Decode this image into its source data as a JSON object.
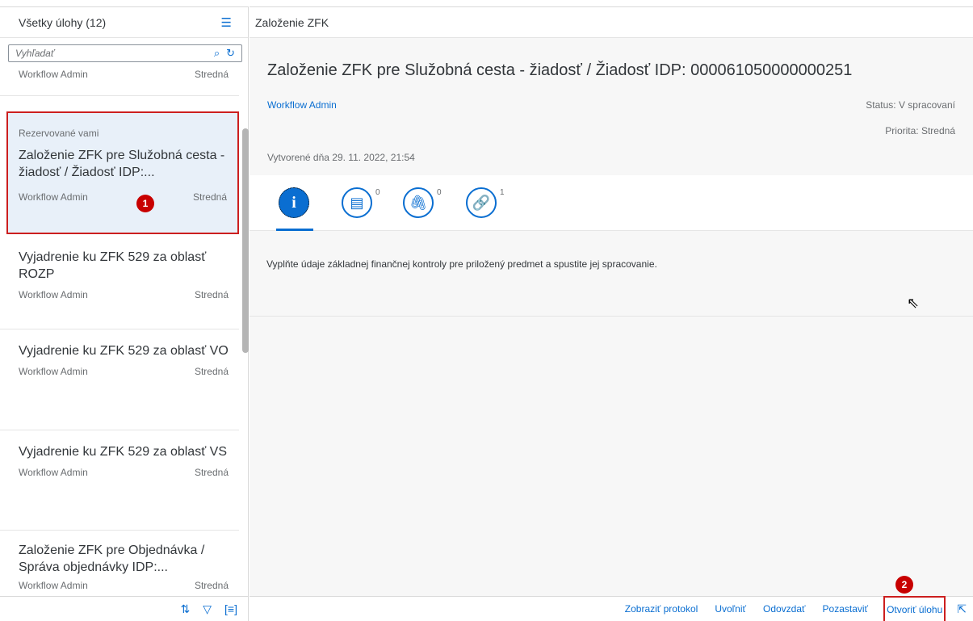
{
  "master": {
    "title": "Všetky úlohy (12)",
    "search_placeholder": "Vyhľadať",
    "items": [
      {
        "sub": "",
        "title": "",
        "creator": "Workflow Admin",
        "priority": "Stredná"
      },
      {
        "sub": "Rezervované vami",
        "title": "Založenie ZFK pre Služobná cesta - žiadosť / Žiadosť IDP:...",
        "creator": "Workflow Admin",
        "priority": "Stredná"
      },
      {
        "sub": "",
        "title": "Vyjadrenie ku ZFK 529 za oblasť ROZP",
        "creator": "Workflow Admin",
        "priority": "Stredná"
      },
      {
        "sub": "",
        "title": "Vyjadrenie ku ZFK 529 za oblasť VO",
        "creator": "Workflow Admin",
        "priority": "Stredná"
      },
      {
        "sub": "",
        "title": "Vyjadrenie ku ZFK 529 za oblasť VS",
        "creator": "Workflow Admin",
        "priority": "Stredná"
      },
      {
        "sub": "",
        "title": "Založenie ZFK pre Objednávka / Správa objednávky IDP:...",
        "creator": "Workflow Admin",
        "priority": "Stredná"
      }
    ],
    "badge1": "1"
  },
  "detail": {
    "topbar_title": "Založenie ZFK",
    "title": "Založenie ZFK pre Služobná cesta - žiadosť / Žiadosť IDP: 000061050000000251",
    "created_by": "Workflow Admin",
    "status": "Status: V spracovaní",
    "priority": "Priorita: Stredná",
    "created_on": "Vytvorené dňa 29. 11. 2022, 21:54",
    "tabs": {
      "notes_count": "0",
      "attachments_count": "0",
      "links_count": "1"
    },
    "description": "Vyplňte údaje základnej finančnej kontroly pre priložený predmet a spustite jej spracovanie.",
    "badge2": "2"
  },
  "actions": {
    "log": "Zobraziť protokol",
    "release": "Uvoľniť",
    "forward": "Odovzdať",
    "suspend": "Pozastaviť",
    "open": "Otvoriť úlohu"
  }
}
